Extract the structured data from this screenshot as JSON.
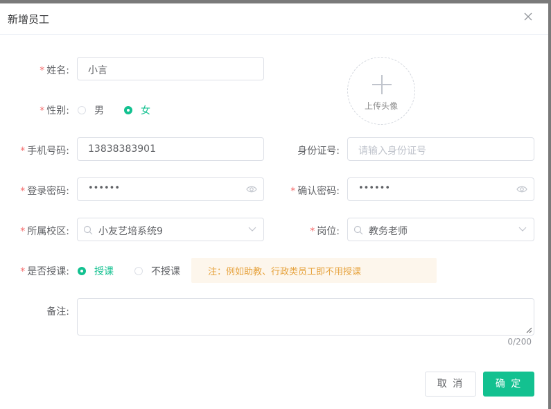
{
  "dialog": {
    "title": "新增员工"
  },
  "form": {
    "name": {
      "label": "姓名:",
      "value": "小言"
    },
    "gender": {
      "label": "性别:",
      "options": [
        "男",
        "女"
      ],
      "selected": "女"
    },
    "avatar": {
      "label": "上传头像"
    },
    "phone": {
      "label": "手机号码:",
      "value": "13838383901"
    },
    "id_card": {
      "label": "身份证号:",
      "placeholder": "请输入身份证号"
    },
    "password": {
      "label": "登录密码:",
      "value": "••••••"
    },
    "confirm_password": {
      "label": "确认密码:",
      "value": "••••••"
    },
    "campus": {
      "label": "所属校区:",
      "value": "小友艺培系统9"
    },
    "position": {
      "label": "岗位:",
      "value": "教务老师"
    },
    "teaching": {
      "label": "是否授课:",
      "options": [
        "授课",
        "不授课"
      ],
      "selected": "授课",
      "note": "注：例如助教、行政类员工即不用授课"
    },
    "remark": {
      "label": "备注:",
      "counter": "0/200"
    }
  },
  "footer": {
    "cancel_label": "取 消",
    "ok_label": "确 定"
  },
  "colors": {
    "accent": "#13c190",
    "required": "#f56c6c",
    "note_text": "#e6a23c",
    "note_bg": "#fdf6ec"
  }
}
